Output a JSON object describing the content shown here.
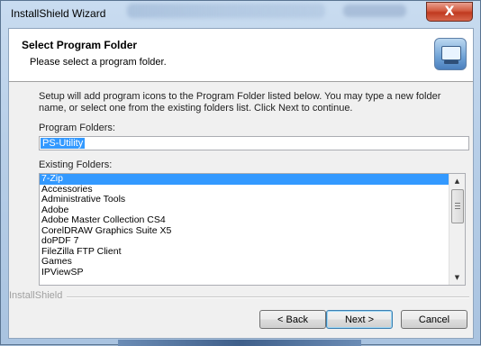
{
  "window": {
    "title": "InstallShield Wizard",
    "close_glyph": "X"
  },
  "header": {
    "title": "Select Program Folder",
    "subtitle": "Please select a program folder.",
    "icon": "setup-computer-icon"
  },
  "body": {
    "description": "Setup will add program icons to the Program Folder listed below.  You may type a new folder name, or select one from the existing folders list.  Click Next to continue.",
    "program_folders_label": "Program Folders:",
    "program_folder_value": "PS-Utility",
    "existing_folders_label": "Existing Folders:",
    "existing_folders": [
      "7-Zip",
      "Accessories",
      "Administrative Tools",
      "Adobe",
      "Adobe Master Collection CS4",
      "CorelDRAW Graphics Suite X5",
      "doPDF 7",
      "FileZilla FTP Client",
      "Games",
      "IPViewSP"
    ],
    "selected_index": 0
  },
  "footer": {
    "brand": "InstallShield",
    "back_label": "< Back",
    "next_label": "Next >",
    "cancel_label": "Cancel"
  },
  "colors": {
    "selection": "#3399ff",
    "close_button": "#c0391f"
  }
}
